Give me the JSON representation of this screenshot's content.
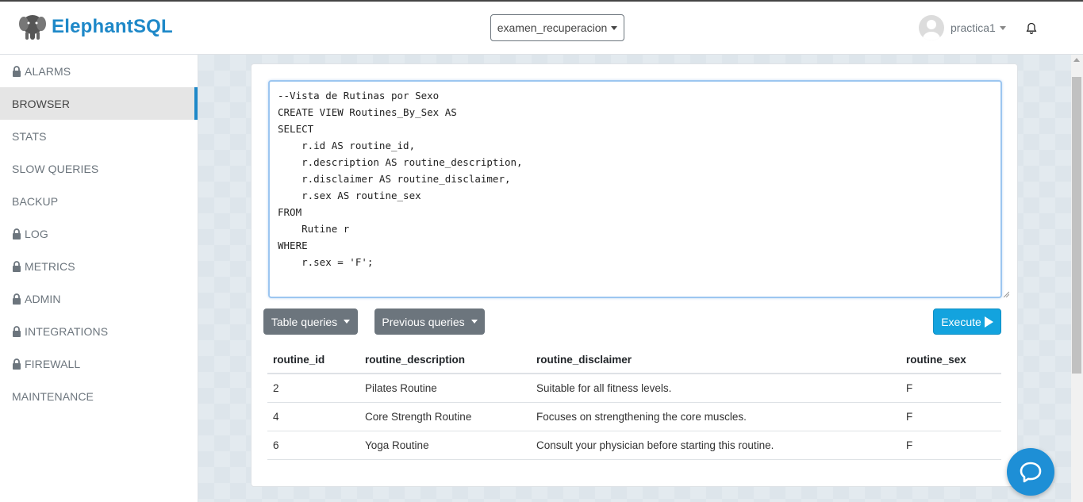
{
  "brand": {
    "name": "ElephantSQL"
  },
  "header": {
    "database_selector": "examen_recuperacion",
    "user_name": "practica1"
  },
  "sidebar": {
    "items": [
      {
        "label": "ALARMS",
        "locked": true,
        "active": false
      },
      {
        "label": "BROWSER",
        "locked": false,
        "active": true
      },
      {
        "label": "STATS",
        "locked": false,
        "active": false
      },
      {
        "label": "SLOW QUERIES",
        "locked": false,
        "active": false
      },
      {
        "label": "BACKUP",
        "locked": false,
        "active": false
      },
      {
        "label": "LOG",
        "locked": true,
        "active": false
      },
      {
        "label": "METRICS",
        "locked": true,
        "active": false
      },
      {
        "label": "ADMIN",
        "locked": true,
        "active": false
      },
      {
        "label": "INTEGRATIONS",
        "locked": true,
        "active": false
      },
      {
        "label": "FIREWALL",
        "locked": true,
        "active": false
      },
      {
        "label": "MAINTENANCE",
        "locked": false,
        "active": false
      }
    ]
  },
  "editor": {
    "query": "--Vista de Rutinas por Sexo\nCREATE VIEW Routines_By_Sex AS\nSELECT\n    r.id AS routine_id,\n    r.description AS routine_description,\n    r.disclaimer AS routine_disclaimer,\n    r.sex AS routine_sex\nFROM\n    Rutine r\nWHERE\n    r.sex = 'F';"
  },
  "toolbar": {
    "table_queries_label": "Table queries",
    "previous_queries_label": "Previous queries",
    "execute_label": "Execute"
  },
  "results": {
    "columns": [
      "routine_id",
      "routine_description",
      "routine_disclaimer",
      "routine_sex"
    ],
    "rows": [
      [
        "2",
        "Pilates Routine",
        "Suitable for all fitness levels.",
        "F"
      ],
      [
        "4",
        "Core Strength Routine",
        "Focuses on strengthening the core muscles.",
        "F"
      ],
      [
        "6",
        "Yoga Routine",
        "Consult your physician before starting this routine.",
        "F"
      ]
    ]
  },
  "colors": {
    "brand": "#1e88c8",
    "execute_button": "#13a3de",
    "secondary_button": "#6c757d",
    "help_button": "#1e8fd6"
  },
  "icons": {
    "logo": "elephant-logo-icon",
    "lock": "lock-icon",
    "bell": "bell-icon",
    "play": "play-icon",
    "help": "chat-help-icon"
  }
}
